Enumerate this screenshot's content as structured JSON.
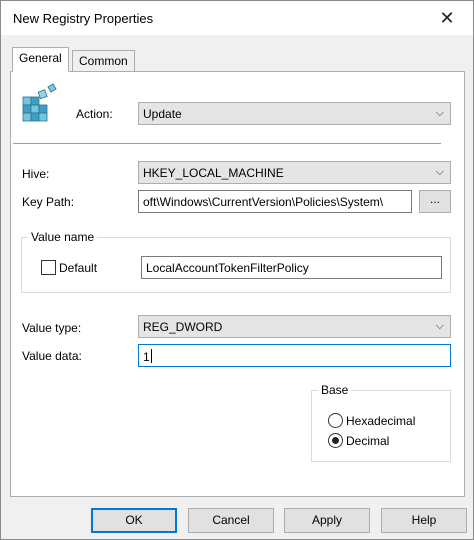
{
  "window": {
    "title": "New Registry Properties",
    "close_glyph": "✕"
  },
  "tabs": [
    {
      "label": "General",
      "active": true
    },
    {
      "label": "Common",
      "active": false
    }
  ],
  "action": {
    "label": "Action:",
    "value": "Update"
  },
  "hive": {
    "label": "Hive:",
    "value": "HKEY_LOCAL_MACHINE"
  },
  "key_path": {
    "label": "Key Path:",
    "value": "oft\\Windows\\CurrentVersion\\Policies\\System\\",
    "browse_label": "..."
  },
  "value_name": {
    "group_title": "Value name",
    "default_label": "Default",
    "default_checked": false,
    "value": "LocalAccountTokenFilterPolicy"
  },
  "value_type": {
    "label": "Value type:",
    "value": "REG_DWORD"
  },
  "value_data": {
    "label": "Value data:",
    "value": "1"
  },
  "base": {
    "group_title": "Base",
    "options": [
      {
        "label": "Hexadecimal",
        "checked": false
      },
      {
        "label": "Decimal",
        "checked": true
      }
    ]
  },
  "buttons": {
    "ok": "OK",
    "cancel": "Cancel",
    "apply": "Apply",
    "help": "Help"
  },
  "icons": {
    "registry": "registry-icon",
    "dropdown": "chevron-down-icon"
  },
  "colors": {
    "focus": "#0078d7"
  }
}
